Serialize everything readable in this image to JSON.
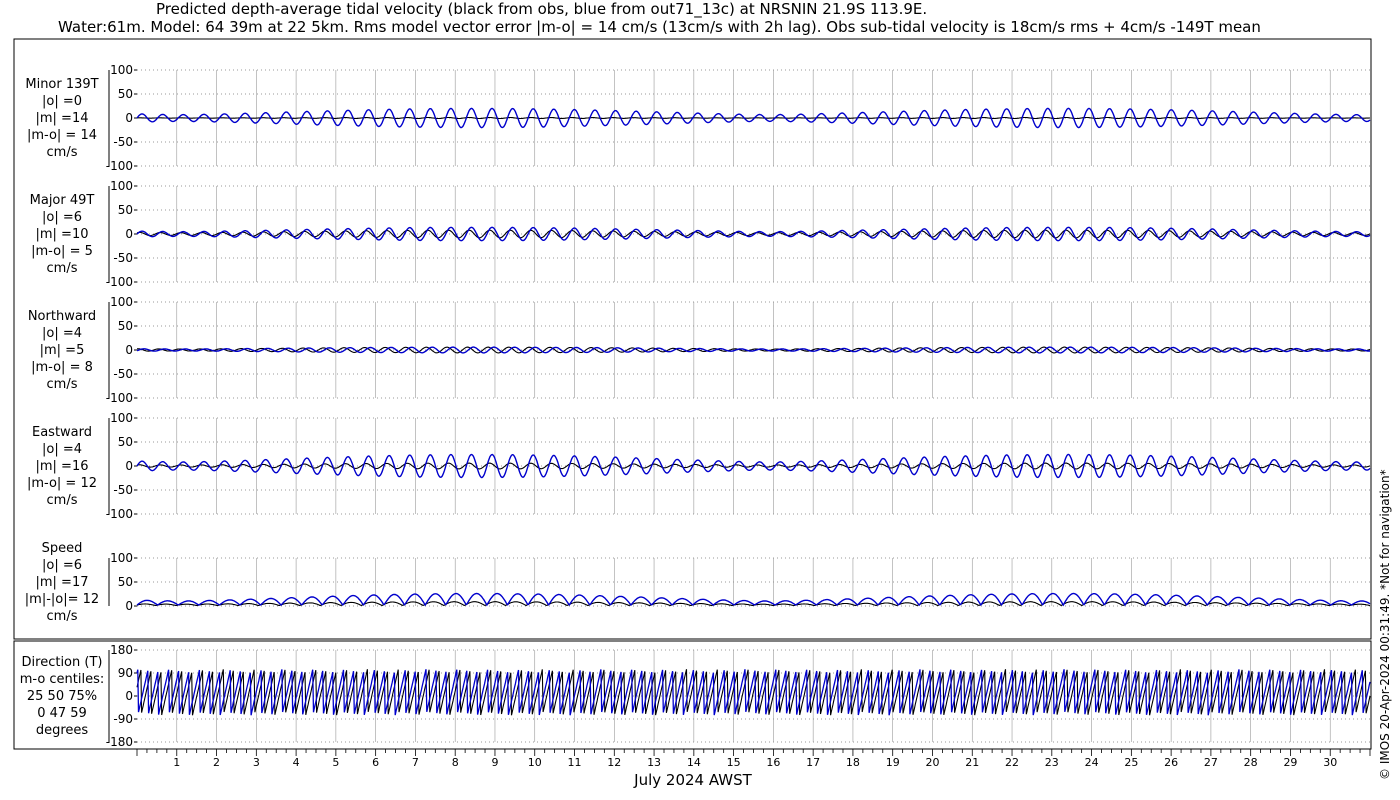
{
  "title_line1": "Predicted depth-average tidal velocity (black from obs, blue from out71_13c) at NRSNIN 21.9S 113.9E.",
  "title_line2": "Water:61m. Model: 64 39m at 22 5km. Rms model vector error |m-o| = 14 cm/s (13cm/s with 2h lag). Obs sub-tidal velocity is 18cm/s rms + 4cm/s -149T mean",
  "xlabel": "July 2024 AWST",
  "copyright": "© IMOS 20-Apr-2024 00:31:49. *Not for navigation*",
  "colors": {
    "obs": "#000000",
    "model": "#0000cc"
  },
  "chart_data": [
    {
      "type": "line",
      "panel": "minor",
      "label": [
        "Minor 139T",
        "|o| =0",
        "|m| =14",
        "|m-o| = 14",
        "cm/s"
      ],
      "yticks": [
        -100,
        -50,
        0,
        50,
        100
      ],
      "ylim": [
        -100,
        100
      ],
      "grid": true,
      "series": [
        {
          "name": "obs",
          "amplitude": 1
        },
        {
          "name": "model",
          "amplitude": 20
        }
      ]
    },
    {
      "type": "line",
      "panel": "major",
      "label": [
        "Major 49T",
        "|o| =6",
        "|m| =10",
        "|m-o| = 5",
        "cm/s"
      ],
      "yticks": [
        -100,
        -50,
        0,
        50,
        100
      ],
      "ylim": [
        -100,
        100
      ],
      "grid": true,
      "series": [
        {
          "name": "obs",
          "amplitude": 8
        },
        {
          "name": "model",
          "amplitude": 14
        }
      ]
    },
    {
      "type": "line",
      "panel": "north",
      "label": [
        "Northward",
        "|o| =4",
        "|m| =5",
        "|m-o| = 8",
        "cm/s"
      ],
      "yticks": [
        -100,
        -50,
        0,
        50,
        100
      ],
      "ylim": [
        -100,
        100
      ],
      "grid": true,
      "series": [
        {
          "name": "obs",
          "amplitude": 6
        },
        {
          "name": "model",
          "amplitude": 6
        }
      ]
    },
    {
      "type": "line",
      "panel": "east",
      "label": [
        "Eastward",
        "|o| =4",
        "|m| =16",
        "|m-o| = 12",
        "cm/s"
      ],
      "yticks": [
        -100,
        -50,
        0,
        50,
        100
      ],
      "ylim": [
        -100,
        100
      ],
      "grid": true,
      "series": [
        {
          "name": "obs",
          "amplitude": 6
        },
        {
          "name": "model",
          "amplitude": 24
        }
      ]
    },
    {
      "type": "line",
      "panel": "speed",
      "label": [
        "Speed",
        "|o| =6",
        "|m| =17",
        "|m|-|o|= 12",
        "cm/s"
      ],
      "yticks": [
        0,
        50,
        100
      ],
      "ylim": [
        0,
        100
      ],
      "grid": true,
      "series": [
        {
          "name": "obs",
          "amplitude": 8
        },
        {
          "name": "model",
          "amplitude": 24
        }
      ]
    },
    {
      "type": "line",
      "panel": "direction",
      "label": [
        "Direction (T)",
        "m-o centiles:",
        "25  50  75%",
        "0  47  59",
        "degrees"
      ],
      "yticks": [
        -180,
        -90,
        0,
        90,
        180
      ],
      "ylim": [
        -180,
        180
      ],
      "grid": true,
      "series": [
        {
          "name": "obs"
        },
        {
          "name": "model"
        }
      ]
    }
  ],
  "x_axis": {
    "days": [
      "1",
      "2",
      "3",
      "4",
      "5",
      "6",
      "7",
      "8",
      "9",
      "10",
      "11",
      "12",
      "13",
      "14",
      "15",
      "16",
      "17",
      "18",
      "19",
      "20",
      "21",
      "22",
      "23",
      "24",
      "25",
      "26",
      "27",
      "28",
      "29",
      "30"
    ],
    "range_days": [
      0,
      31
    ]
  }
}
